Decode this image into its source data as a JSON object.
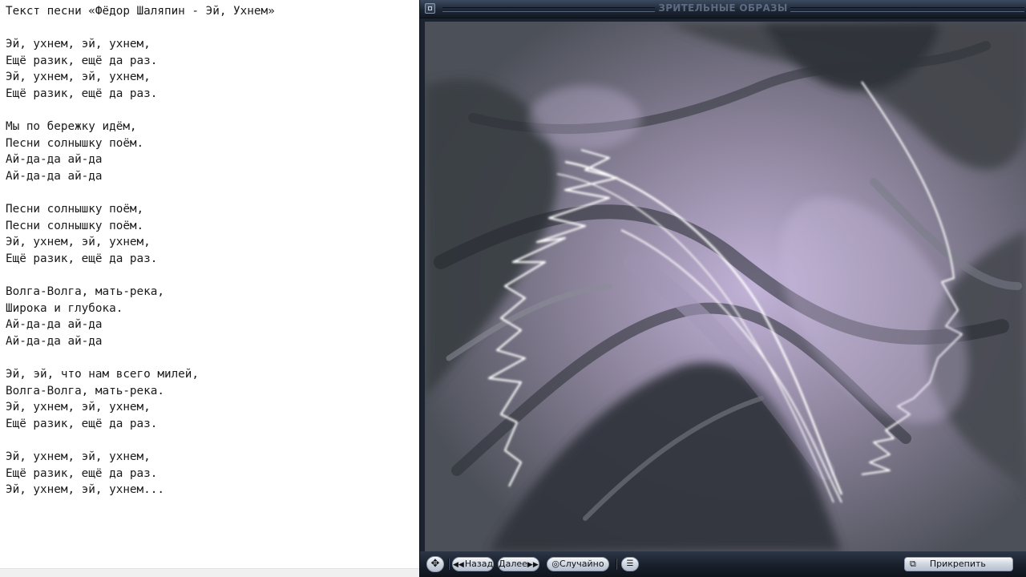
{
  "lyrics": {
    "lines": [
      "Текст песни «Фёдор Шаляпин - Эй, Ухнем»",
      "",
      "Эй, ухнем, эй, ухнем,",
      "Ещё разик, ещё да раз.",
      "Эй, ухнем, эй, ухнем,",
      "Ещё разик, ещё да раз.",
      "",
      "Мы по бережку идём,",
      "Песни солнышку поём.",
      "Ай-да-да ай-да",
      "Ай-да-да ай-да",
      "",
      "Песни солнышку поём,",
      "Песни солнышку поём.",
      "Эй, ухнем, эй, ухнем,",
      "Ещё разик, ещё да раз.",
      "",
      "Волга-Волга, мать-река,",
      "Широка и глубока.",
      "Ай-да-да ай-да",
      "Ай-да-да ай-да",
      "",
      "Эй, эй, что нам всего милей,",
      "Волга-Волга, мать-река.",
      "Эй, ухнем, эй, ухнем,",
      "Ещё разик, ещё да раз.",
      "",
      "Эй, ухнем, эй, ухнем,",
      "Ещё разик, ещё да раз.",
      "Эй, ухнем, эй, ухнем..."
    ]
  },
  "player": {
    "title": "ЗРИТЕЛЬНЫЕ ОБРАЗЫ",
    "icons": {
      "system": "window-menu-icon",
      "move": "move-arrows-icon",
      "back": "double-left-arrow-icon",
      "next": "double-right-arrow-icon",
      "random": "random-circle-icon",
      "menu": "list-menu-icon",
      "attach": "attach-window-icon"
    },
    "controls": {
      "back_label": "Назад",
      "next_label": "Далее",
      "random_label": "Случайно",
      "attach_label": "Прикрепить"
    },
    "colors": {
      "frame": "#1b2230",
      "button_face": "#cfd6e0",
      "viz_base": "#5c5f68",
      "viz_highlight": "#b8a9cf"
    }
  }
}
